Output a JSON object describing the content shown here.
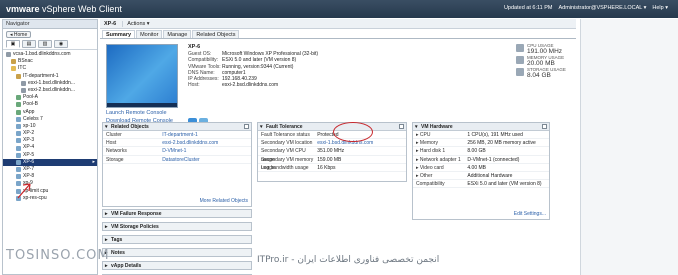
{
  "top_bar": {
    "brand_prefix": "vmware",
    "brand_suffix": " vSphere Web Client",
    "updated": "Updated at 6:11 PM",
    "user": "Administrator@VSPHERE.LOCAL ▾",
    "help": "Help ▾"
  },
  "navigator": {
    "title": "Navigator",
    "home": "◂ Home",
    "tabs": [
      "▣",
      "▤",
      "▥",
      "◉"
    ],
    "tree": [
      {
        "label": "vcsa-1.bsd.dlinkddns.com",
        "icon": "vcenter",
        "indent": 0
      },
      {
        "label": "BSnac",
        "icon": "datacenter",
        "indent": 1
      },
      {
        "label": "ITC",
        "icon": "folder",
        "indent": 1
      },
      {
        "label": "IT-department-1",
        "icon": "cluster",
        "indent": 2
      },
      {
        "label": "esxi-1.bsd.dlinkddn...",
        "icon": "host",
        "indent": 3
      },
      {
        "label": "esxi-2.bsd.dlinkddn...",
        "icon": "host",
        "indent": 3
      },
      {
        "label": "Pool-A",
        "icon": "pool",
        "indent": 2
      },
      {
        "label": "Pool-B",
        "icon": "pool",
        "indent": 2
      },
      {
        "label": "vApp",
        "icon": "pool",
        "indent": 2
      },
      {
        "label": "Celebs 7",
        "icon": "vm",
        "indent": 2
      },
      {
        "label": "xp-10",
        "icon": "vm",
        "indent": 2
      },
      {
        "label": "XP-2",
        "icon": "vm",
        "indent": 2
      },
      {
        "label": "XP-3",
        "icon": "vm",
        "indent": 2
      },
      {
        "label": "XP-4",
        "icon": "vm",
        "indent": 2
      },
      {
        "label": "XP-5",
        "icon": "vm",
        "indent": 2
      },
      {
        "label": "XP-6",
        "icon": "vm",
        "indent": 2,
        "selected": true
      },
      {
        "label": "XP-7",
        "icon": "vm",
        "indent": 2
      },
      {
        "label": "XP-8",
        "icon": "vm",
        "indent": 2
      },
      {
        "label": "xp-9",
        "icon": "vm",
        "indent": 2
      },
      {
        "label": "xp-limit cpu",
        "icon": "vm",
        "indent": 2
      },
      {
        "label": "xp-res-cpu",
        "icon": "vm",
        "indent": 2
      }
    ]
  },
  "object_bar": {
    "name": "XP-6",
    "actions": "Actions ▾"
  },
  "tabs": [
    "Summary",
    "Monitor",
    "Manage",
    "Related Objects"
  ],
  "summary": {
    "vm_name": "XP-6",
    "info": [
      {
        "k": "Guest OS:",
        "v": "Microsoft Windows XP Professional (32-bit)"
      },
      {
        "k": "Compatibility:",
        "v": "ESXi 5.0 and later (VM version 8)"
      },
      {
        "k": "VMware Tools:",
        "v": "Running, version:9344 (Current)"
      },
      {
        "k": "DNS Name:",
        "v": "computer1"
      },
      {
        "k": "IP Addresses:",
        "v": "192.168.40.239"
      },
      {
        "k": "Host:",
        "v": "esxi-2.bsd.dlinkddns.com"
      }
    ],
    "launch_console": "Launch Remote Console",
    "download_console": "Download Remote Console",
    "usage": [
      {
        "label": "CPU USAGE",
        "value": "191.00 MHz"
      },
      {
        "label": "MEMORY USAGE",
        "value": "20.00 MB"
      },
      {
        "label": "STORAGE USAGE",
        "value": "8.04 GB"
      }
    ]
  },
  "related_objects": {
    "title": "Related Objects",
    "rows": [
      {
        "k": "Cluster",
        "v": "IT-department-1"
      },
      {
        "k": "Host",
        "v": "esxi-2.bsd.dlinkddns.com"
      },
      {
        "k": "Networks",
        "v": "D-VMnet-1"
      },
      {
        "k": "Storage",
        "v": "DatastoreCluster"
      }
    ],
    "footer": "More Related Objects"
  },
  "fault_tolerance": {
    "title": "Fault Tolerance",
    "rows": [
      {
        "k": "Fault Tolerance status",
        "v": "Protected"
      },
      {
        "k": "Secondary VM location",
        "v": "esxi-1.bsd.dlinkddns.com"
      },
      {
        "k": "Secondary VM CPU usage",
        "v": "351.00 MHz"
      },
      {
        "k": "Secondary VM memory usage",
        "v": "159.00 MB"
      },
      {
        "k": "Log bandwidth usage",
        "v": "16 Kbps"
      }
    ]
  },
  "vm_hardware": {
    "title": "VM Hardware",
    "rows": [
      {
        "k": "▸ CPU",
        "v": "1 CPU(s), 191 MHz used"
      },
      {
        "k": "▸ Memory",
        "v": "256 MB, 20 MB memory active"
      },
      {
        "k": "▸ Hard disk 1",
        "v": "8.00 GB"
      },
      {
        "k": "▸ Network adapter 1",
        "v": "D-VMnet-1   (connected)"
      },
      {
        "k": "▸ Video card",
        "v": "4.00 MB"
      },
      {
        "k": "▸ Other",
        "v": "Additional Hardware"
      },
      {
        "k": "Compatibility",
        "v": "ESXi 5.0 and later (VM version 8)"
      }
    ],
    "footer": "Edit Settings..."
  },
  "collapsed_panels": [
    "VM Failure Response",
    "VM Storage Policies",
    "Tags",
    "Notes",
    "vApp Details",
    "Advanced Configuration"
  ],
  "watermarks": {
    "left": "TOSINSO.COM",
    "right": "ITPro.ir - انجمن تخصصی فناوری اطلاعات ایران"
  }
}
